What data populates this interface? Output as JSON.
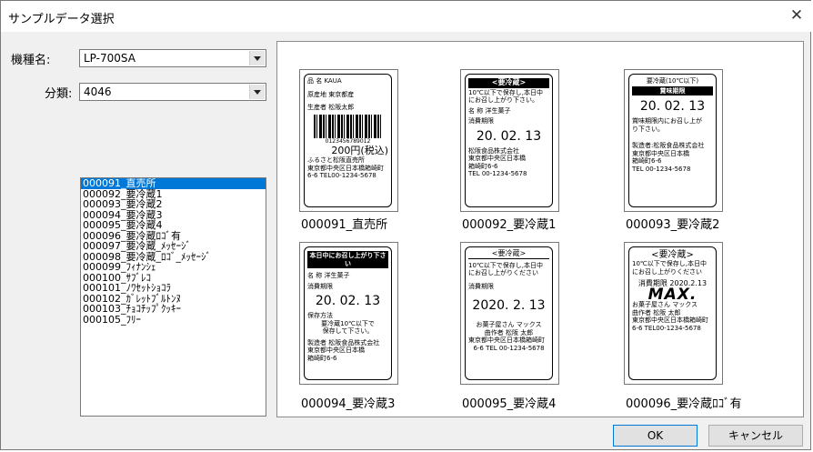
{
  "window": {
    "title": "サンプルデータ選択",
    "close_glyph": "✕"
  },
  "form": {
    "model_label": "機種名:",
    "model_value": "LP-700SA",
    "category_label": "分類:",
    "category_value": "4046"
  },
  "list": {
    "items": [
      "000091_直売所",
      "000092_要冷蔵1",
      "000093_要冷蔵2",
      "000094_要冷蔵3",
      "000095_要冷蔵4",
      "000096_要冷蔵ﾛｺﾞ有",
      "000097_要冷蔵_ﾒｯｾｰｼﾞ",
      "000098_要冷蔵_ﾛｺﾞ_ﾒｯｾｰｼﾞ",
      "000099_ﾌｨﾅﾝｼｪ",
      "000100_ｻﾌﾞﾚｺ",
      "000101_ﾉﾜｾｯﾄｼｮｺﾗ",
      "000102_ｶﾞﾚｯﾄﾌﾞﾙﾄﾝﾇ",
      "000103_ﾁｮｺﾁｯﾌﾟｸｯｷｰ",
      "000105_ﾌﾘｰ"
    ],
    "selected_index": 0
  },
  "thumbnails": [
    {
      "caption": "000091_直売所",
      "l1": "品 名 KAUA",
      "l2": "原産地 東京都産",
      "l3": "生産者 松阪太郎",
      "barcode_num": "0123456789012",
      "price": "200円(税込)",
      "l4": "ふるさと松阪直売所",
      "l5": "東京都中央区日本橋箱崎町",
      "l6": "6-6 TEL00-1234-5678"
    },
    {
      "caption": "000092_要冷蔵1",
      "header": "<要冷蔵>",
      "l1": "10℃以下で保存し,本日中",
      "l2": "にお召し上がり下さい。",
      "l3": "名 称 洋生菓子",
      "l4": "消費期限",
      "date": "20. 02. 13",
      "l5": "松阪食品株式会社",
      "l6": "東京都中央区日本橋",
      "l7": "箱崎町6-6",
      "l8": "TEL 00-1234-5678"
    },
    {
      "caption": "000093_要冷蔵2",
      "header_top": "要冷蔵(10℃以下)",
      "band": "賞味期限",
      "date": "20. 02. 13",
      "l1": "賞味期限内にお召し上が",
      "l2": "り下さい。",
      "l3": "製造者:松阪食品株式会社",
      "l4": "東京都中央区日本橋",
      "l5": "箱崎町6-6",
      "l6": "TEL 00-1234-5678"
    },
    {
      "caption": "000094_要冷蔵3",
      "band": "本日中にお召し上がり下さい",
      "l1": "名 称 洋生菓子",
      "l2": "消費期限",
      "date": "20. 02. 13",
      "l3": "保存方法",
      "l4": "要冷蔵10℃以下で",
      "l5": "保存して下さい。",
      "l6": "製造者 松阪食品株式会社",
      "l7": "東京都中央区日本橋",
      "l8": "箱崎町6-6"
    },
    {
      "caption": "000095_要冷蔵4",
      "header": "<要冷蔵>",
      "l1": "10℃以下で保存し,本日中",
      "l2": "にお召し上がりください",
      "l3": "消費期限",
      "date": "2020. 2. 13",
      "l4": "お菓子屋さん マックス",
      "l5": "曲作者 松阪 太郎",
      "l6": "東京都中央区日本橋箱崎町",
      "l7": "6-6 TEL 00-1234-5678"
    },
    {
      "caption": "000096_要冷蔵ﾛｺﾞ有",
      "header": "<要冷蔵>",
      "l1": "10℃以下で保存し,本日中",
      "l2": "にお召し上がりください",
      "l3": "消費期限 2020.2.13",
      "logo": "MAX.",
      "l4": "お菓子屋さん マックス",
      "l5": "曲作者 松阪 太郎",
      "l6": "東京都中央区日本橋箱崎町",
      "l7": "6-6 TEL00-1234-5678"
    }
  ],
  "buttons": {
    "ok": "OK",
    "cancel": "キャンセル"
  }
}
